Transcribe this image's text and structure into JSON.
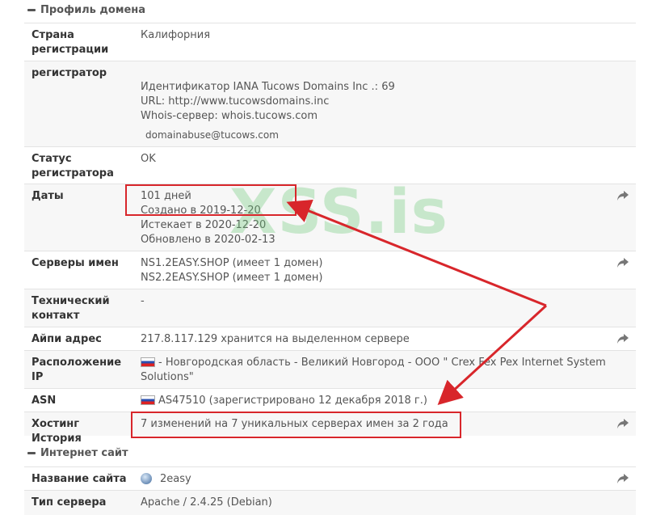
{
  "domain_profile": {
    "title": "Профиль домена",
    "rows": [
      {
        "label": "Страна регистрации",
        "value": "Калифорния"
      },
      {
        "label": "регистратор",
        "lines": [
          "Идентификатор IANA Tucows Domains Inc .: 69",
          "URL: http://www.tucowsdomains.inc",
          "Whois-сервер: whois.tucows.com"
        ],
        "email": "domainabuse@tucows.com"
      },
      {
        "label": "Статус регистратора",
        "value": "OK"
      },
      {
        "label": "Даты",
        "lines": [
          "101 дней",
          "Создано в 2019-12-20",
          "Истекает в 2020-12-20",
          "Обновлено в 2020-02-13"
        ]
      },
      {
        "label": "Серверы имен",
        "lines": [
          "NS1.2EASY.SHOP (имеет 1 домен)",
          "NS2.2EASY.SHOP (имеет 1 домен)"
        ]
      },
      {
        "label": "Технический контакт",
        "value": "-"
      },
      {
        "label": "Айпи адрес",
        "value": "217.8.117.129 хранится на выделенном сервере"
      },
      {
        "label": "Расположение IP",
        "value": "- Новгородская область - Великий Новгород - ООО \" Crex Fex Pex Internet System Solutions\""
      },
      {
        "label": "ASN",
        "value": "AS47510 (зарегистрировано 12 декабря 2018 г.)"
      },
      {
        "label": "Хостинг История",
        "value": "7 изменений на 7 уникальных серверах имен за 2 года"
      }
    ]
  },
  "website": {
    "title": "Интернет сайт",
    "rows": [
      {
        "label": "Название сайта",
        "value": "2easy"
      },
      {
        "label": "Тип сервера",
        "value": "Apache / 2.4.25 (Debian)"
      }
    ]
  },
  "watermark": "XSS.is",
  "colors": {
    "annotation": "#d8262b",
    "watermark": "#6ec878"
  }
}
